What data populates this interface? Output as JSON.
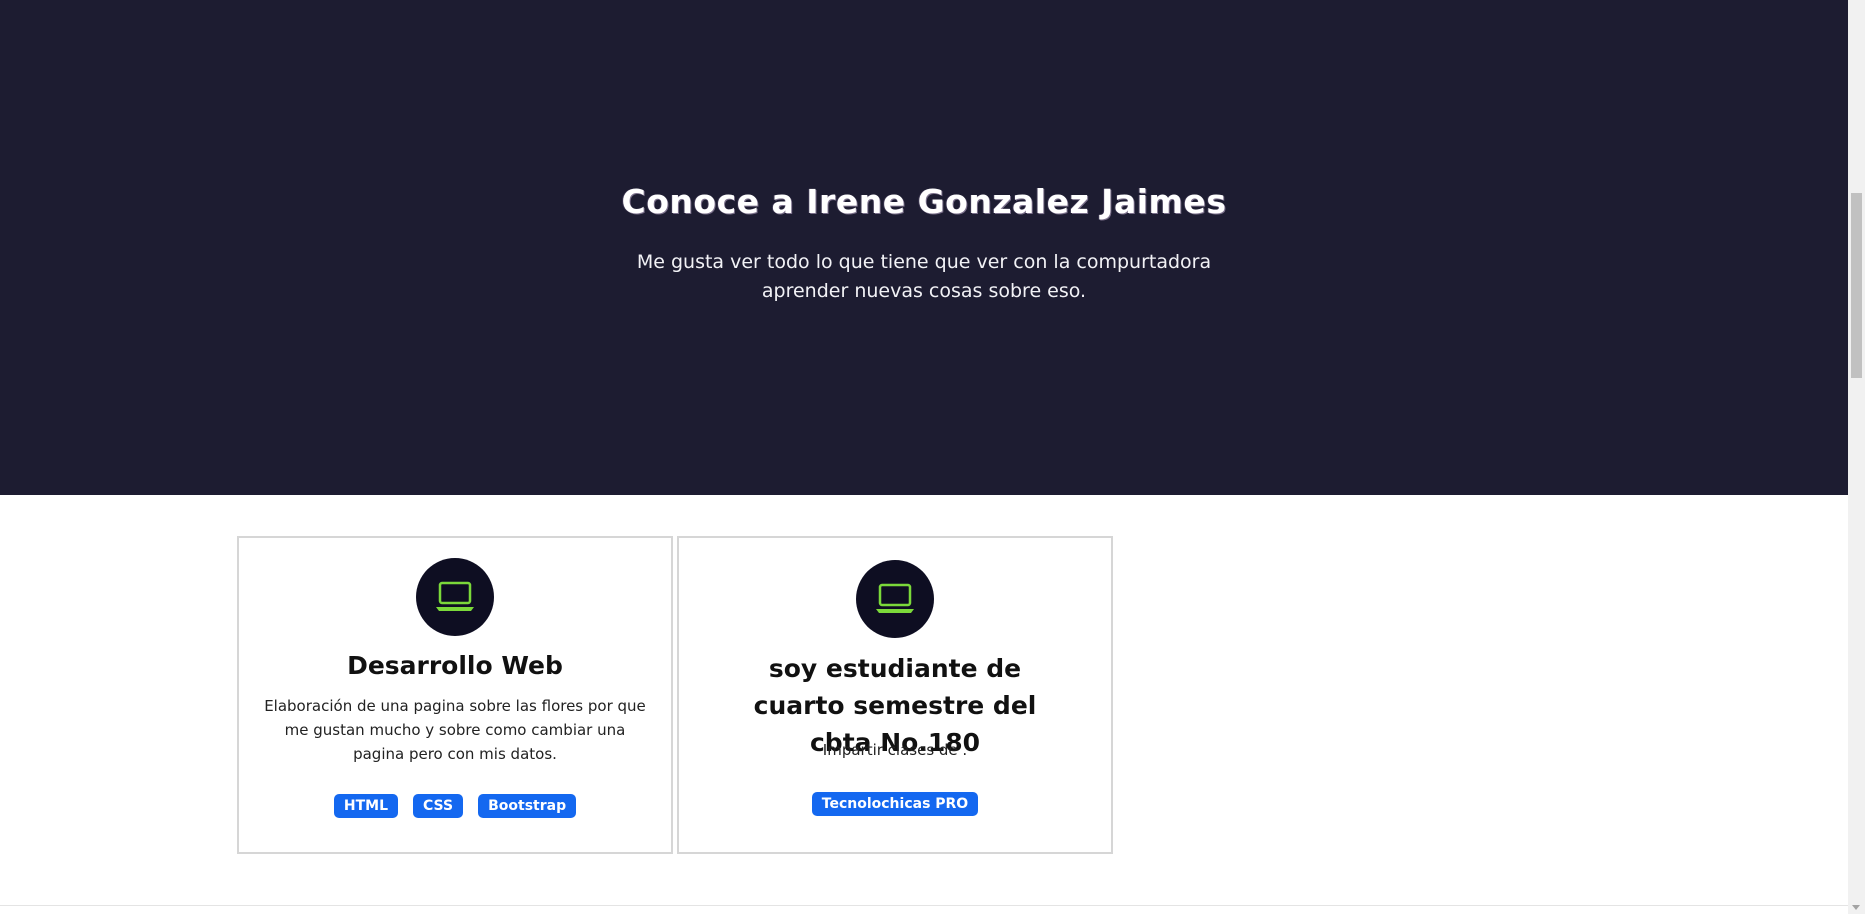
{
  "hero": {
    "title": "Conoce a Irene Gonzalez Jaimes",
    "description": "Me gusta ver todo lo que tiene que ver con la compurtadora aprender nuevas cosas sobre eso.",
    "background_color": "#1d1c31"
  },
  "cards": [
    {
      "icon": "laptop-icon",
      "title": "Desarrollo Web",
      "text": "Elaboración de una pagina sobre las flores por que me gustan mucho y sobre como cambiar una pagina pero con mis datos.",
      "badges": [
        "HTML",
        "CSS",
        "Bootstrap"
      ]
    },
    {
      "icon": "laptop-icon",
      "title": "soy estudiante de cuarto semestre del cbta No.180",
      "text": "Impartir clases de .",
      "badges": [
        "Tecnolochicas PRO"
      ]
    }
  ],
  "colors": {
    "accent_badge": "#1468f0",
    "icon_green": "#7bd93a",
    "icon_circle": "#0e0e22"
  }
}
